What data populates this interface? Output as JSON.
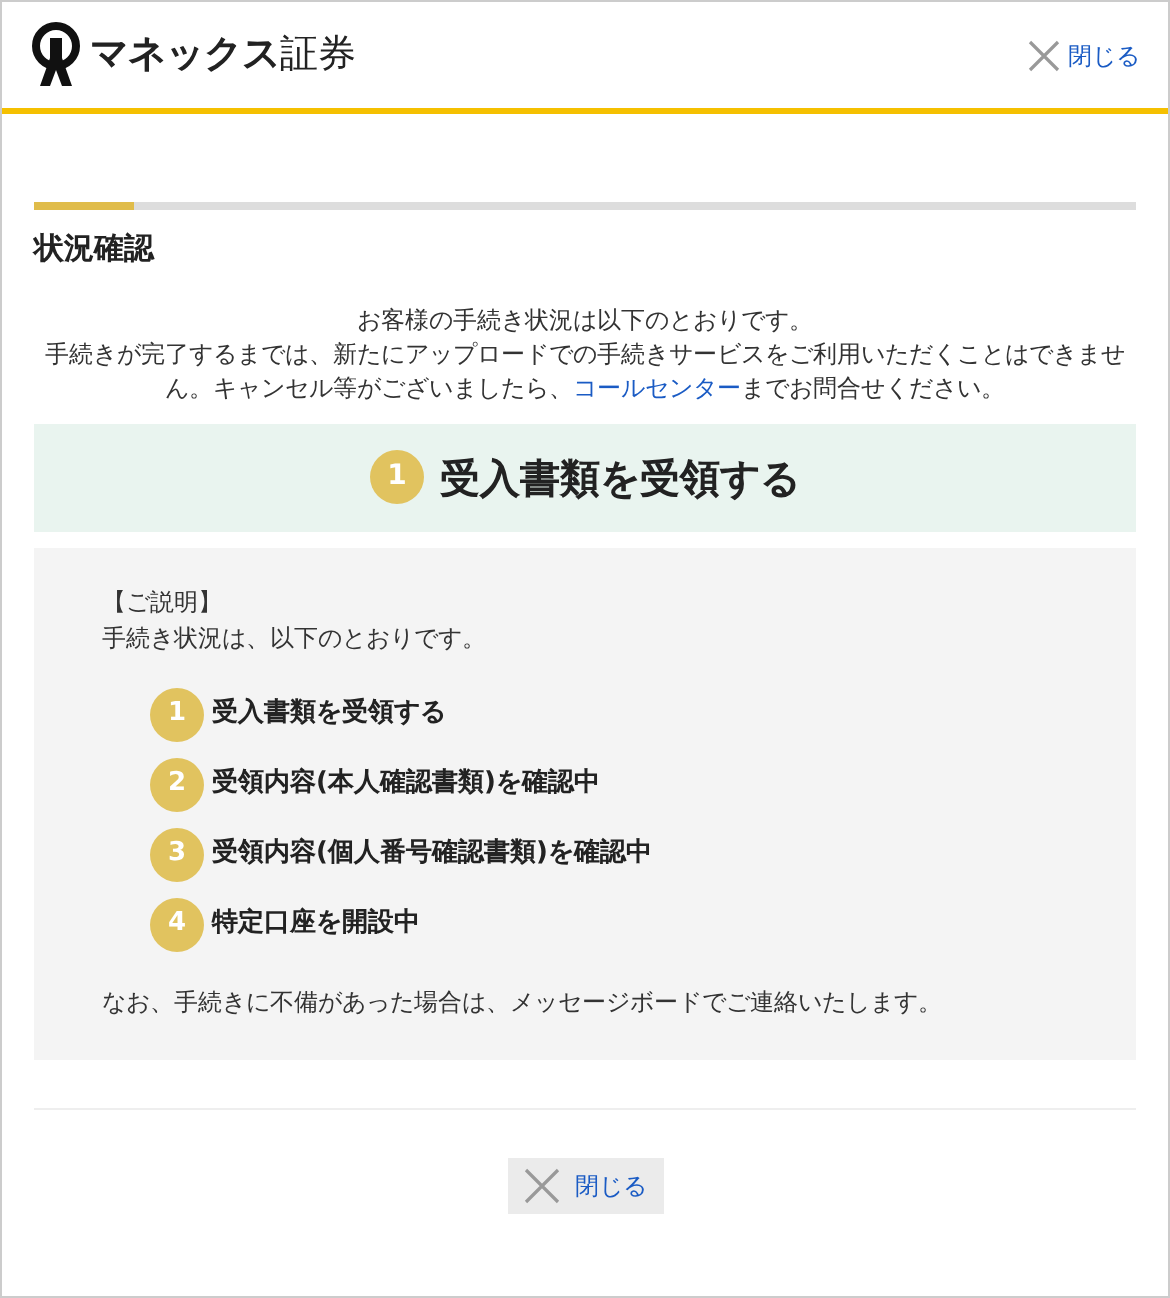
{
  "header": {
    "logo_text": "**マネックス**証券",
    "close_link": "閉じる"
  },
  "progress": {
    "level": 0.09
  },
  "section_title": "状況確認",
  "intro": {
    "line_1": "お客様の手続き状況は以下のとおりです。",
    "before_link": "手続きが完了するまでは、新たにアップロードでの手続きサービスをご利用いただくことはできません。キャンセル等がございましたら、",
    "link": "コールセンター",
    "after_link": "までお問合せください。"
  },
  "current_step": {
    "number": "1",
    "label": "受入書類を受領する"
  },
  "explanation": {
    "heading": "【ご説明】",
    "lead": "手続き状況は、以下のとおりです。",
    "steps": [
      {
        "number": "1",
        "label": "受入書類を受領する"
      },
      {
        "number": "2",
        "label": "受領内容(本人確認書類)を確認中"
      },
      {
        "number": "3",
        "label": "受領内容(個人番号確認書類)を確認中"
      },
      {
        "number": "4",
        "label": "特定口座を開設中"
      }
    ],
    "note": "なお、手続きに不備があった場合は、メッセージボードでご連絡いたします。"
  },
  "footer": {
    "close_button": "閉じる"
  }
}
